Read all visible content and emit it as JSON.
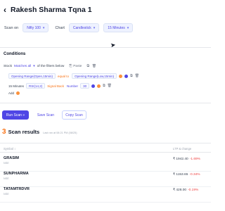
{
  "header": {
    "back_icon": "‹",
    "title": "Rakesh Sharma Tqna 1"
  },
  "scan_controls": {
    "scan_on_label": "Scan on",
    "scan_on_value": "Nifty 100",
    "chart_label": "Chart",
    "chart_value": "Candlestick",
    "timeframe_value": "15 Minutes"
  },
  "conditions": {
    "title": "Conditions",
    "stock_prefix": "Stock",
    "match_value": "Matches all",
    "stock_suffix": "of the filters below",
    "paste_label": "Paste",
    "line1": {
      "left": "Opening Range(Open,15min)",
      "operator": "equal to",
      "right": "Opening Range(Low,15min)"
    },
    "line2": {
      "left": "15 Minutes",
      "left_value": "RSI(14,2)",
      "operator": "Signal Back",
      "number_label": "Number",
      "number_value": "30"
    },
    "add_label": "Add"
  },
  "buttons": {
    "run": "Run Scan »",
    "save": "Save Scan",
    "copy": "Copy Scan"
  },
  "results": {
    "count": "3",
    "title": "Scan results",
    "ran_text": "Last ran at 08:21 PM (08/25)",
    "col_symbol": "Symbol ↕",
    "col_ltp": "LTP & change",
    "rows": [
      {
        "symbol": "GRASIM",
        "exchange": "NSE",
        "ltp": "₹ 1942.40",
        "change": "-1.69%"
      },
      {
        "symbol": "SUNPHARMA",
        "exchange": "NSE",
        "ltp": "₹ 1153.65",
        "change": "-0.34%"
      },
      {
        "symbol": "TATAMTRDVR",
        "exchange": "NSE",
        "ltp": "₹ 428.00",
        "change": "-0.19%"
      }
    ]
  }
}
